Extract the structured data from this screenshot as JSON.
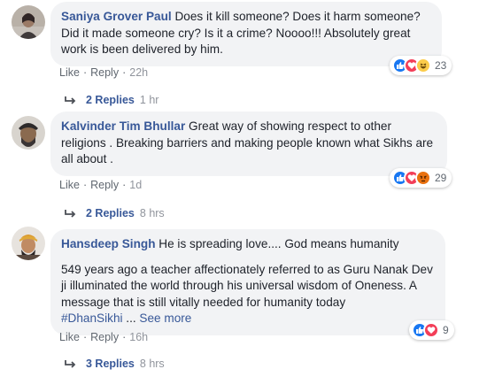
{
  "comments": [
    {
      "author": "Saniya Grover Paul",
      "text": " Does it kill someone? Does it harm someone? Did it made someone cry? Is it a crime? Noooo!!! Absolutely great work is been delivered by him.",
      "like": "Like",
      "reply": "Reply",
      "time": "22h",
      "reaction_count": "23",
      "reactions": [
        "like-icon",
        "love-icon",
        "haha-icon"
      ],
      "replies_label": "2 Replies",
      "replies_time": "1 hr"
    },
    {
      "author": "Kalvinder Tim Bhullar",
      "text": " Great way of showing respect to other religions . Breaking barriers and making people known what Sikhs are all about .",
      "like": "Like",
      "reply": "Reply",
      "time": "1d",
      "reaction_count": "29",
      "reactions": [
        "like-icon",
        "love-icon",
        "angry-icon"
      ],
      "replies_label": "2 Replies",
      "replies_time": "8 hrs"
    },
    {
      "author": "Hansdeep Singh",
      "text": " He is spreading love.... God means humanity",
      "text2": "549 years ago a teacher affectionately referred to as Guru Nanak Dev ji illuminated the world through his universal wisdom of Oneness. A message that is still vitally needed for humanity today",
      "hashtag": "#DhanSikhi",
      "ellipsis": " ... ",
      "see_more": "See more",
      "like": "Like",
      "reply": "Reply",
      "time": "16h",
      "reaction_count": "9",
      "reactions": [
        "like-icon",
        "love-icon"
      ],
      "replies_label": "3 Replies",
      "replies_time": "8 hrs"
    }
  ],
  "colors": {
    "link_blue": "#385898",
    "bubble_bg": "#f2f3f5",
    "meta_gray": "#606770",
    "like_blue": "#1877f2",
    "love_red": "#f33e58",
    "haha_yellow": "#fbcc4b",
    "angry_orange": "#e9710f"
  }
}
